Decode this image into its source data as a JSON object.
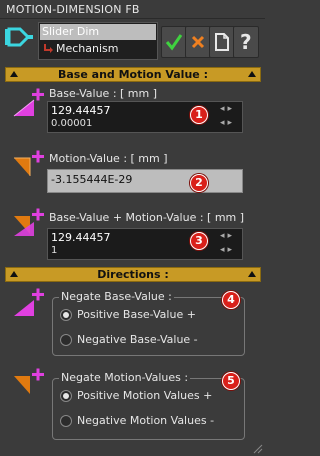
{
  "window": {
    "title": "MOTION-DIMENSION FB"
  },
  "object_list": {
    "item1": "Slider Dim",
    "item2": "Mechanism"
  },
  "toolbar": {
    "ok_icon": "check-icon",
    "cancel_icon": "x-icon",
    "new_icon": "document-icon",
    "help_label": "?"
  },
  "sections": {
    "base_motion": "Base and Motion Value :",
    "directions": "Directions :"
  },
  "base": {
    "label": "Base-Value : [ mm ]",
    "value": "129.44457",
    "step": "0.00001",
    "badge": "1"
  },
  "motion": {
    "label": "Motion-Value : [ mm ]",
    "value": "-3.155444E-29",
    "badge": "2"
  },
  "sum": {
    "label": "Base-Value + Motion-Value : [ mm ]",
    "value": "129.44457",
    "step": "1",
    "badge": "3"
  },
  "negate_base": {
    "title": "Negate Base-Value :",
    "opt1": "Positive Base-Value +",
    "opt2": "Negative Base-Value -",
    "selected": "opt1",
    "badge": "4"
  },
  "negate_motion": {
    "title": "Negate Motion-Values :",
    "opt1": "Positive Motion Values +",
    "opt2": "Negative Motion Values -",
    "selected": "opt1",
    "badge": "5"
  },
  "colors": {
    "accent": "#c89a25",
    "badge": "#d9201a",
    "magenta": "#e040e0",
    "orange": "#e07a10"
  }
}
